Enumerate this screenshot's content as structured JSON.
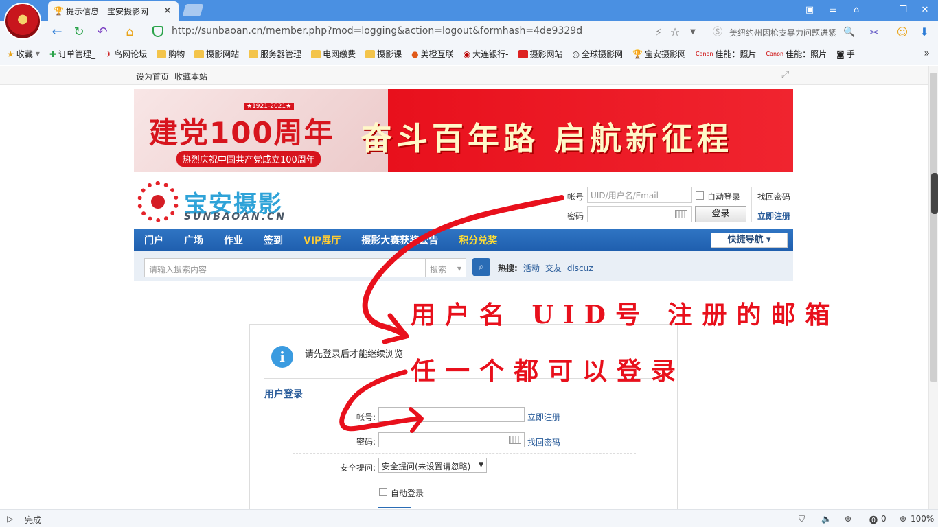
{
  "browser": {
    "tab_title": "提示信息 - 宝安摄影网 -",
    "url": "http://sunbaoan.cn/member.php?mod=logging&action=logout&formhash=4de9329d",
    "news": "美纽约州因枪支暴力问题进紧",
    "status": "完成",
    "zoom": "100%",
    "counter": "0"
  },
  "bookmarks": [
    {
      "label": "收藏",
      "icon": "star-icon"
    },
    {
      "label": "订单管理_",
      "icon": "plus-icon"
    },
    {
      "label": "鸟网论坛",
      "icon": "bird-icon"
    },
    {
      "label": "购物",
      "icon": "folder-icon"
    },
    {
      "label": "摄影网站",
      "icon": "folder-icon"
    },
    {
      "label": "服务器管理",
      "icon": "folder-icon"
    },
    {
      "label": "电网缴费",
      "icon": "folder-icon"
    },
    {
      "label": "摄影课",
      "icon": "folder-icon"
    },
    {
      "label": "美橙互联",
      "icon": "apple-icon"
    },
    {
      "label": "大连银行-",
      "icon": "bank-icon"
    },
    {
      "label": "摄影网站",
      "icon": "red-icon"
    },
    {
      "label": "全球摄影网",
      "icon": "eye-icon"
    },
    {
      "label": "宝安摄影网",
      "icon": "trophy-icon"
    },
    {
      "label": "佳能：照片",
      "icon": "canon-icon"
    },
    {
      "label": "佳能：照片",
      "icon": "canon-icon"
    },
    {
      "label": "手",
      "icon": "camera-icon"
    }
  ],
  "topbar": {
    "home": "设为首页",
    "fav": "收藏本站"
  },
  "banner": {
    "title": "建党100周年",
    "years": "★1921-2021★",
    "sub": "热烈庆祝中国共产党成立100周年",
    "slogan": "奋斗百年路 启航新征程"
  },
  "logo": {
    "name": "宝安摄影",
    "sub": "SUNBAOAN.CN"
  },
  "header_login": {
    "account_label": "帐号",
    "account_placeholder": "UID/用户名/Email",
    "password_label": "密码",
    "auto_login": "自动登录",
    "login_button": "登录",
    "forgot": "找回密码",
    "register": "立即注册"
  },
  "nav": {
    "items": [
      "门户",
      "广场",
      "作业",
      "签到",
      "VIP展厅",
      "摄影大赛获奖公告",
      "积分兑奖"
    ],
    "quick": "快捷导航 ▾"
  },
  "search": {
    "placeholder": "请输入搜索内容",
    "select": "搜索",
    "hot_label": "热搜:",
    "hot": [
      "活动",
      "交友",
      "discuz"
    ]
  },
  "login": {
    "notice": "请先登录后才能继续浏览",
    "title": "用户登录",
    "account_label": "帐号:",
    "register": "立即注册",
    "password_label": "密码:",
    "forgot": "找回密码",
    "question_label": "安全提问:",
    "question_value": "安全提问(未设置请忽略)",
    "auto_login": "自动登录"
  },
  "annotations": {
    "line1": "用户名 UID号 注册的邮箱",
    "line2": "任一个都可以登录"
  }
}
